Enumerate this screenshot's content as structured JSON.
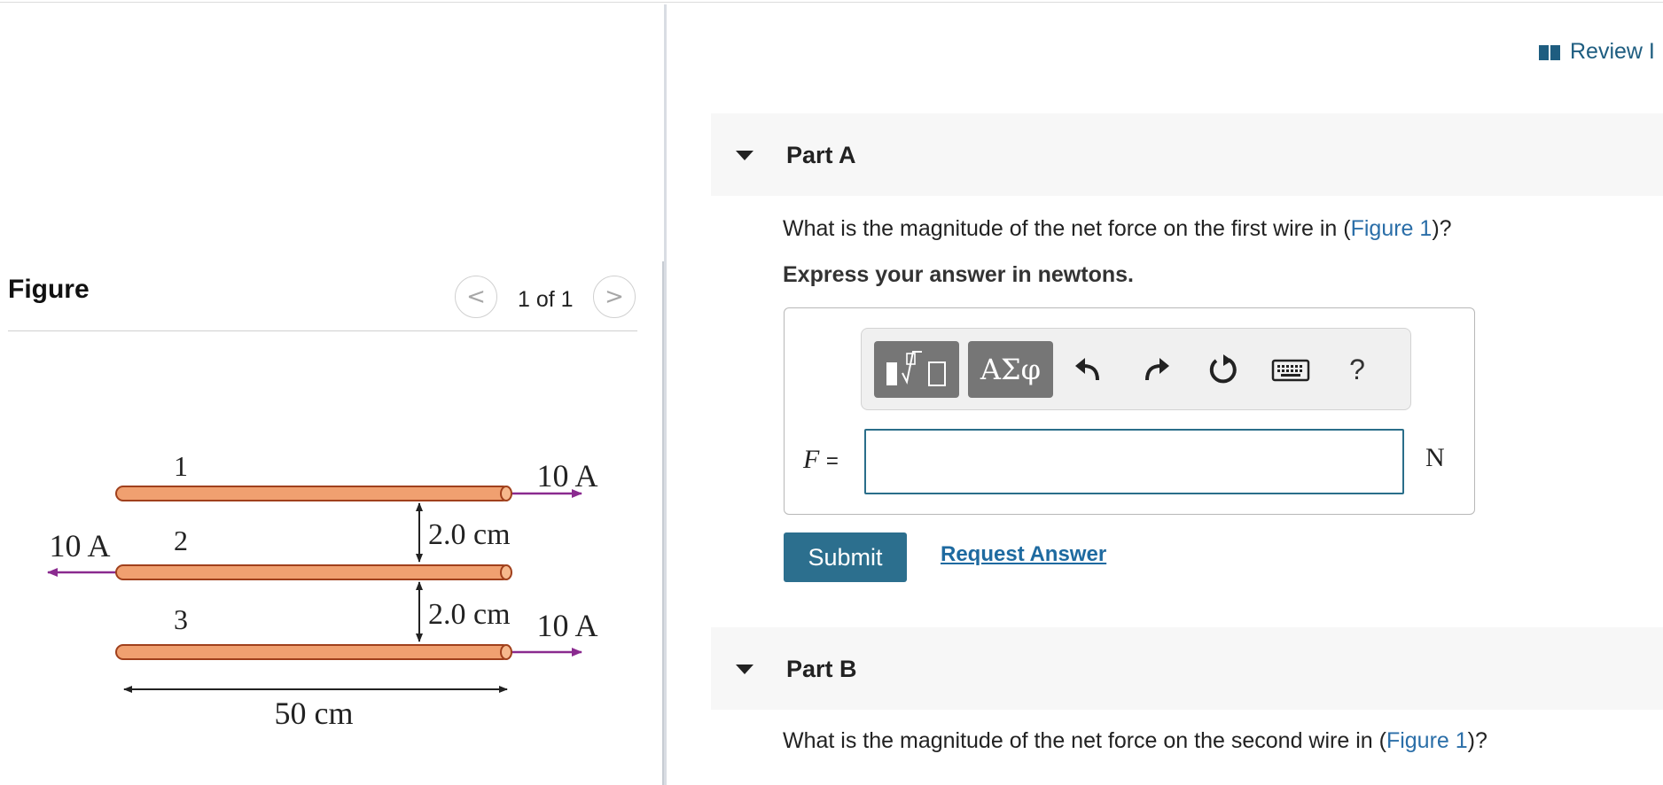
{
  "header": {
    "review_label": "Review I"
  },
  "figure": {
    "title": "Figure",
    "pager_prev": "<",
    "pager_text": "1 of 1",
    "pager_next": ">",
    "diagram": {
      "wire1_label": "1",
      "wire2_label": "2",
      "wire3_label": "3",
      "current1": "10 A",
      "current2": "10 A",
      "current3": "10 A",
      "spacing1": "2.0 cm",
      "spacing2": "2.0 cm",
      "length": "50 cm"
    },
    "colors": {
      "wire": "#f0a070",
      "wire_outline": "#a0401c",
      "arrow": "#8a2a8f"
    }
  },
  "part_a": {
    "label": "Part A",
    "question_prefix": "What is the magnitude of the net force on the first wire in (",
    "figure_link": "Figure 1",
    "question_suffix": ")?",
    "instruction": "Express your answer in newtons.",
    "toolbar": {
      "templates_icon": "templates-icon",
      "symbols_label": "ΑΣφ",
      "undo_icon": "undo-icon",
      "redo_icon": "redo-icon",
      "reset_icon": "reset-icon",
      "keyboard_icon": "keyboard-icon",
      "help_label": "?"
    },
    "variable": "F",
    "equals": "=",
    "input_value": "",
    "unit": "N",
    "submit_label": "Submit",
    "request_label": "Request Answer"
  },
  "part_b": {
    "label": "Part B",
    "question_prefix": "What is the magnitude of the net force on the second wire in (",
    "figure_link": "Figure 1",
    "question_suffix": ")?"
  }
}
